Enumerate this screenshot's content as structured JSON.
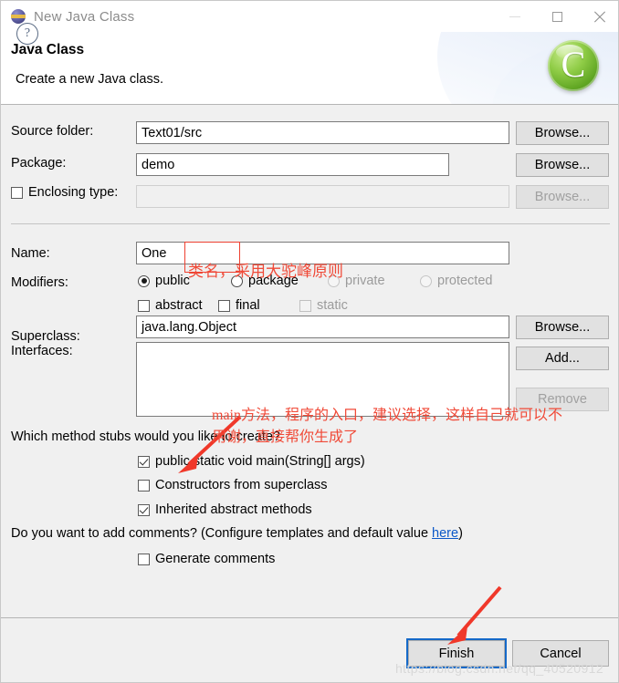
{
  "window": {
    "title": "New Java Class",
    "icon": "eclipse-sphere-icon",
    "minimize_label": "—",
    "maximize_label": "□",
    "close_label": "✕"
  },
  "banner": {
    "heading": "Java Class",
    "description": "Create a new Java class.",
    "logo_glyph": "C"
  },
  "form": {
    "source_folder": {
      "label": "Source folder:",
      "value": "Text01/src",
      "browse_label": "Browse..."
    },
    "package": {
      "label": "Package:",
      "value": "demo",
      "browse_label": "Browse..."
    },
    "enclosing_type": {
      "label": "Enclosing type:",
      "value": "",
      "checked": false,
      "browse_label": "Browse..."
    },
    "name": {
      "label": "Name:",
      "value": "One"
    },
    "modifiers": {
      "label": "Modifiers:",
      "access": [
        {
          "label": "public",
          "checked": true,
          "enabled": true
        },
        {
          "label": "package",
          "checked": false,
          "enabled": true
        },
        {
          "label": "private",
          "checked": false,
          "enabled": false
        },
        {
          "label": "protected",
          "checked": false,
          "enabled": false
        }
      ],
      "flags": [
        {
          "label": "abstract",
          "checked": false,
          "enabled": true
        },
        {
          "label": "final",
          "checked": false,
          "enabled": true
        },
        {
          "label": "static",
          "checked": false,
          "enabled": false
        }
      ]
    },
    "superclass": {
      "label": "Superclass:",
      "value": "java.lang.Object",
      "browse_label": "Browse..."
    },
    "interfaces": {
      "label": "Interfaces:",
      "items": [],
      "add_label": "Add...",
      "remove_label": "Remove"
    },
    "method_stubs": {
      "question": "Which method stubs would you like to create?",
      "options": [
        {
          "label": "public static void main(String[] args)",
          "checked": true
        },
        {
          "label": "Constructors from superclass",
          "checked": false
        },
        {
          "label": "Inherited abstract methods",
          "checked": true
        }
      ]
    },
    "comments": {
      "question_before": "Do you want to add comments? (Configure templates and default value ",
      "link_label": "here",
      "question_after": ")",
      "generate": {
        "label": "Generate comments",
        "checked": false
      }
    }
  },
  "footer": {
    "help_label": "?",
    "finish_label": "Finish",
    "cancel_label": "Cancel"
  },
  "annotations": {
    "name_note": "类名，采用大驼峰原则",
    "main_note_line1": "main方法，程序的入口，建议选择，这样自己就可以不",
    "main_note_line2": "用谢，直接帮你生成了",
    "accent_color": "#f04a38"
  },
  "watermark": {
    "text": "https://blog.csdn.net/qq_40520912"
  }
}
